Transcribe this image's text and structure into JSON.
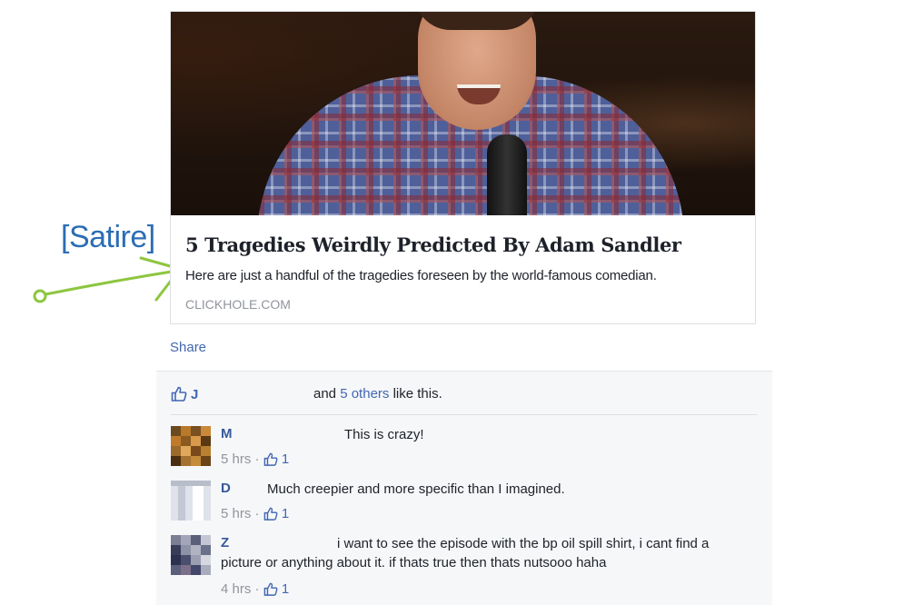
{
  "annotation": {
    "label": "[Satire]",
    "color": "#2c6db4",
    "arrow_color": "#8dc63f"
  },
  "card": {
    "title": "5 Tragedies Weirdly Predicted By Adam Sandler",
    "description": "Here are just a handful of the tragedies foreseen by the world-famous comedian.",
    "domain": "CLICKHOLE.COM"
  },
  "share_label": "Share",
  "likes": {
    "icon": "thumbs-up-icon",
    "liker": "J",
    "prefix": "and ",
    "others": "5 others",
    "suffix": " like this."
  },
  "comments": [
    {
      "author": "M",
      "text": "This is crazy!",
      "time": "5 hrs",
      "sep": " · ",
      "likes": "1"
    },
    {
      "author": "D",
      "text": "Much creepier and more specific than I imagined.",
      "time": "5 hrs",
      "sep": " · ",
      "likes": "1"
    },
    {
      "author": "Z",
      "text": "i want to see the episode with the bp oil spill shirt, i cant find a",
      "text_cont": "picture or anything about it. if thats true then thats nutsooo haha",
      "time": "4 hrs",
      "sep": " · ",
      "likes": "1"
    }
  ],
  "colors": {
    "link": "#4267b2",
    "author": "#365899",
    "muted": "#90949c",
    "panel_bg": "#f6f7f9"
  }
}
